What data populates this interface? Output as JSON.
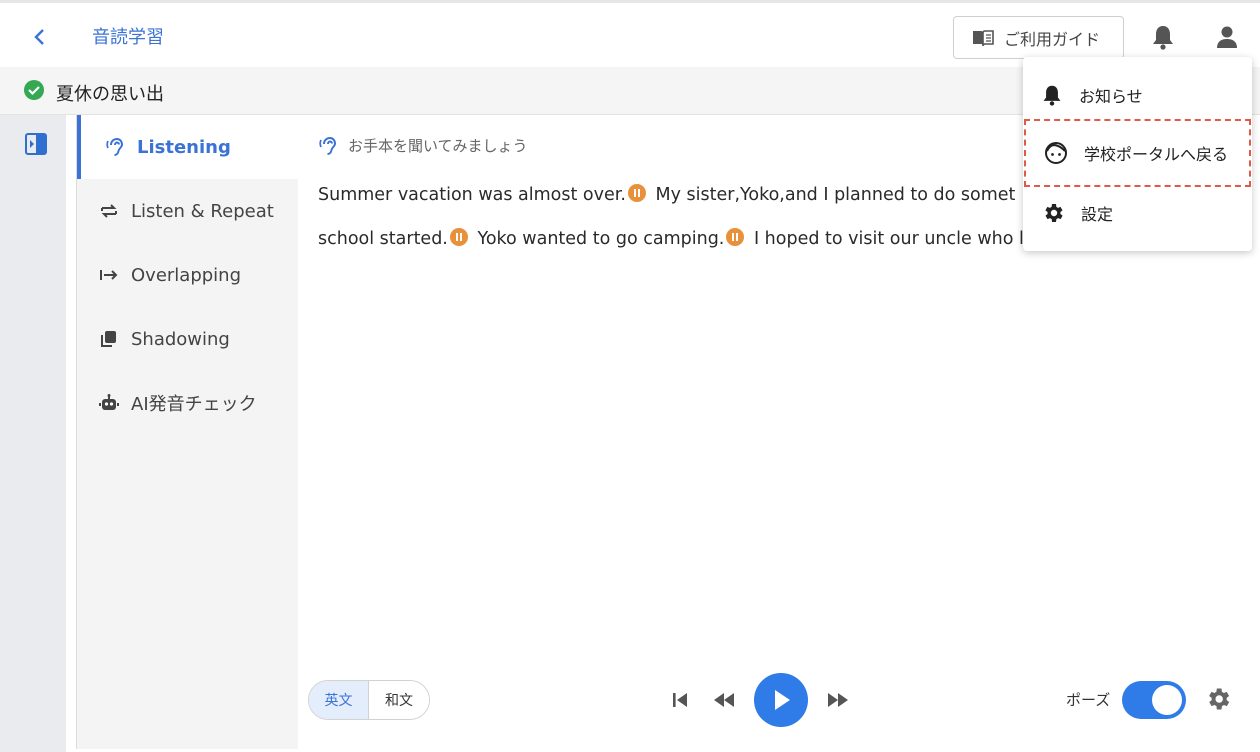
{
  "header": {
    "back_icon": "chevron-left-icon",
    "app_title": "音読学習",
    "guide_label": "ご利用ガイド",
    "guide_icon": "book-icon",
    "bell_icon": "bell-icon",
    "user_icon": "user-icon"
  },
  "lesson": {
    "status_icon": "check-circle-icon",
    "title": "夏休の思い出"
  },
  "modes": [
    {
      "label": "Listening",
      "icon": "ear-icon",
      "active": true
    },
    {
      "label": "Listen & Repeat",
      "icon": "repeat-icon",
      "active": false
    },
    {
      "label": "Overlapping",
      "icon": "arrow-right-bar-icon",
      "active": false
    },
    {
      "label": "Shadowing",
      "icon": "copy-icon",
      "active": false
    },
    {
      "label": "AI発音チェック",
      "icon": "robot-icon",
      "active": false
    }
  ],
  "panel": {
    "hint": "お手本を聞いてみましょう",
    "passage_line1": [
      "Summer vacation was almost over.",
      "My sister,Yoko,and I planned to do somet"
    ],
    "passage_line2": [
      "school started.",
      "Yoko wanted to go camping.",
      "I hoped to visit our uncle who liv"
    ]
  },
  "controls": {
    "lang_en": "英文",
    "lang_ja": "和文",
    "pause_label": "ポーズ",
    "pause_enabled": true
  },
  "dropdown": {
    "items": [
      {
        "label": "お知らせ",
        "icon": "bell-icon"
      },
      {
        "label": "学校ポータルへ戻る",
        "icon": "face-icon"
      },
      {
        "label": "設定",
        "icon": "gear-icon"
      }
    ]
  },
  "colors": {
    "accent": "#3b72d6",
    "play": "#2f7be8",
    "pause_marker": "#e8913a",
    "success": "#34a853",
    "highlight_border": "#e05a4a"
  }
}
